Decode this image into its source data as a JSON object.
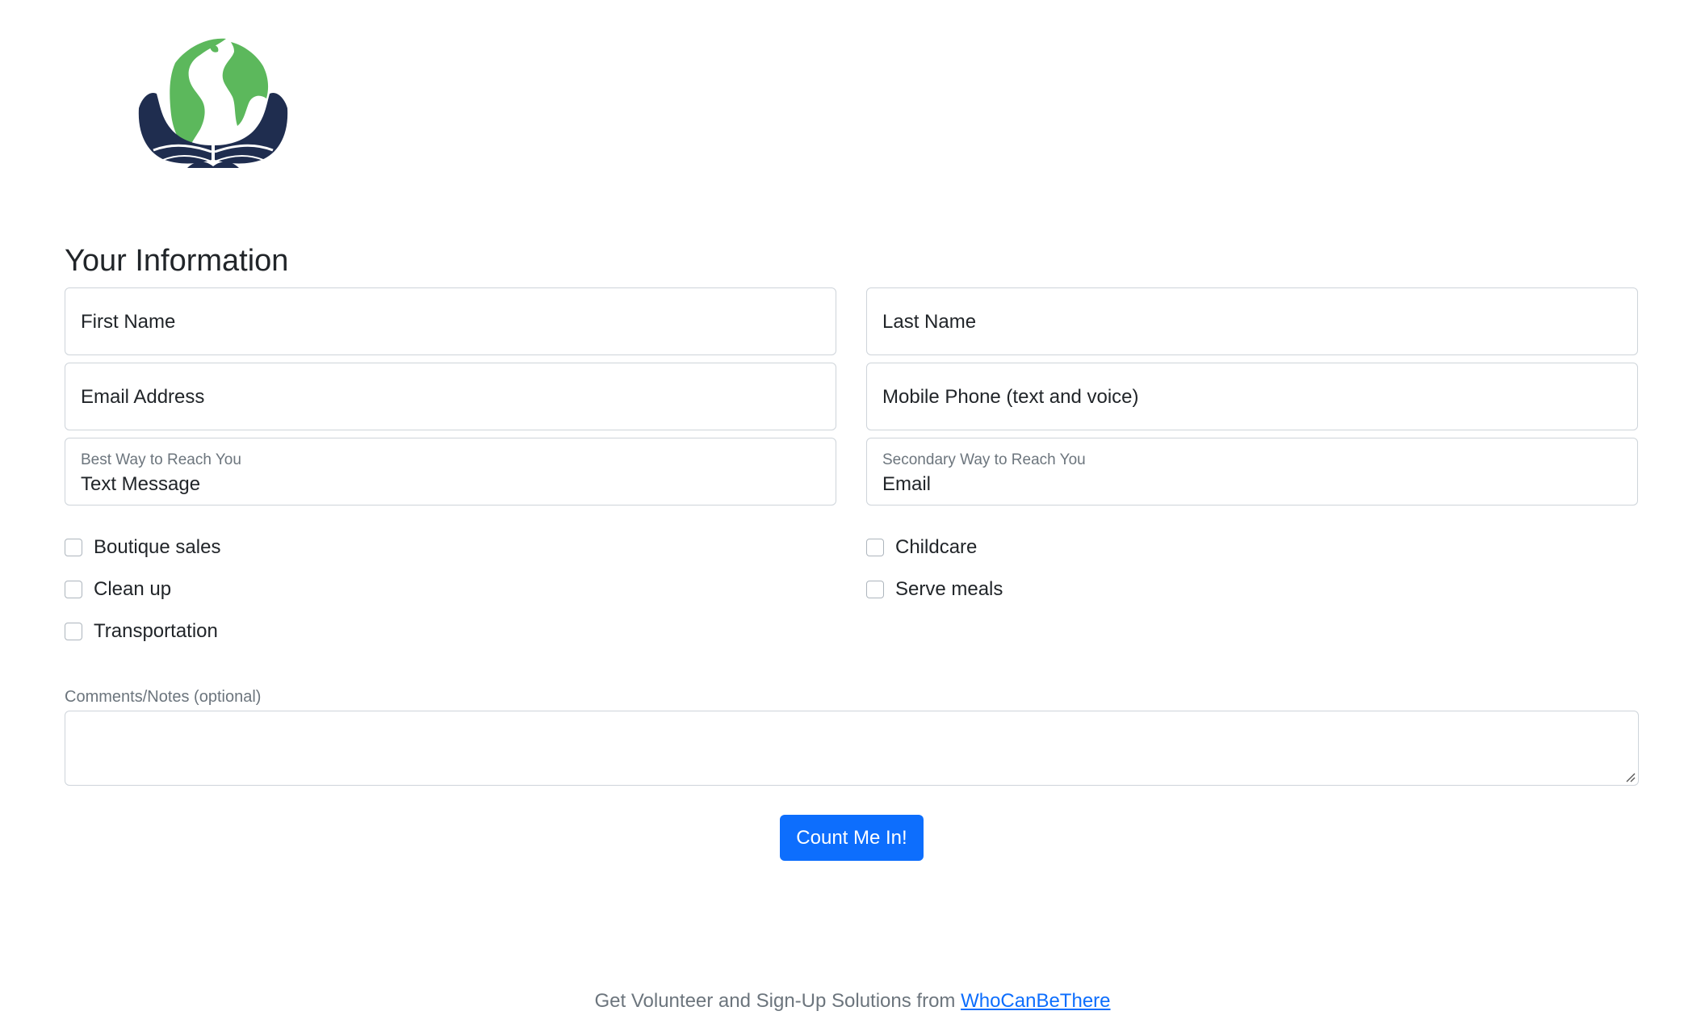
{
  "form": {
    "title": "Your Information",
    "fields": {
      "first_name": {
        "placeholder": "First Name"
      },
      "last_name": {
        "placeholder": "Last Name"
      },
      "email": {
        "placeholder": "Email Address"
      },
      "mobile": {
        "placeholder": "Mobile Phone (text and voice)"
      },
      "best_way": {
        "label": "Best Way to Reach You",
        "value": "Text Message"
      },
      "secondary_way": {
        "label": "Secondary Way to Reach You",
        "value": "Email"
      }
    },
    "checkboxes": {
      "boutique_sales": "Boutique sales",
      "clean_up": "Clean up",
      "transportation": "Transportation",
      "childcare": "Childcare",
      "serve_meals": "Serve meals"
    },
    "comments_label": "Comments/Notes (optional)",
    "submit_label": "Count Me In!"
  },
  "footer": {
    "text": "Get Volunteer and Sign-Up Solutions from ",
    "link_text": "WhoCanBeThere"
  },
  "colors": {
    "primary": "#0d6efd",
    "logo_green": "#5cb85c",
    "logo_navy": "#1f2d4f",
    "muted_text": "#6c757d",
    "border": "#ced4da"
  },
  "icons": {
    "logo": "globe-in-hands-icon",
    "resize": "resize-grip-icon"
  }
}
